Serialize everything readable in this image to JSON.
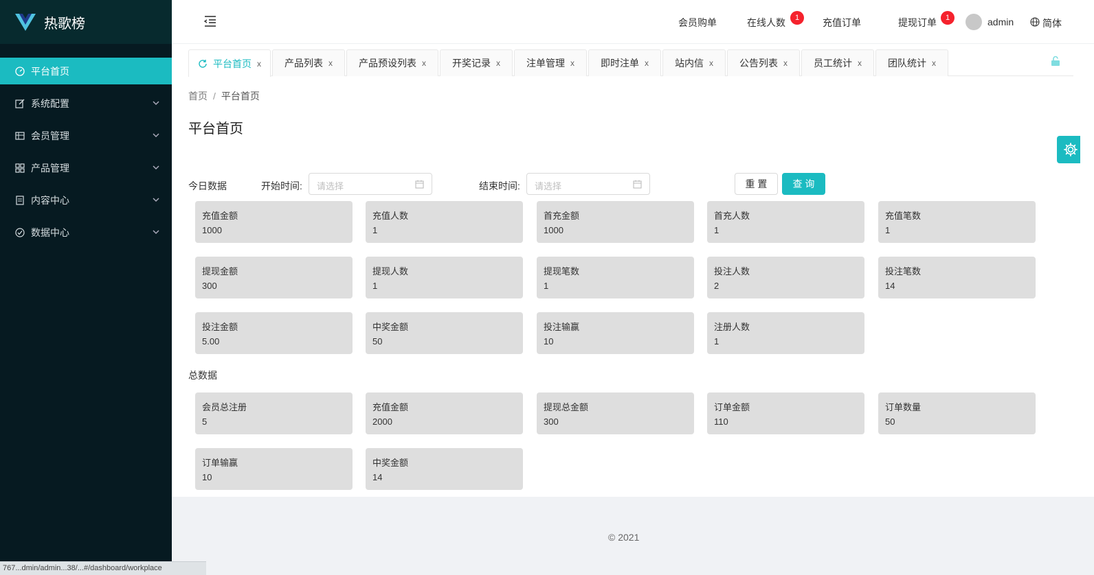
{
  "app": {
    "title": "热歌榜"
  },
  "sidebar": {
    "items": [
      {
        "label": "平台首页",
        "icon": "dashboard-icon",
        "active": true
      },
      {
        "label": "系统配置",
        "icon": "edit-icon"
      },
      {
        "label": "会员管理",
        "icon": "table-icon"
      },
      {
        "label": "产品管理",
        "icon": "grid-icon"
      },
      {
        "label": "内容中心",
        "icon": "document-icon"
      },
      {
        "label": "数据中心",
        "icon": "check-circle-icon"
      }
    ]
  },
  "header": {
    "links": [
      "会员购单",
      "在线人数",
      "充值订单",
      "提现订单"
    ],
    "online_badge": "1",
    "withdraw_badge": "1",
    "user": "admin",
    "language": "简体"
  },
  "tabs": [
    {
      "label": "平台首页",
      "active": true
    },
    {
      "label": "产品列表"
    },
    {
      "label": "产品预设列表"
    },
    {
      "label": "开奖记录"
    },
    {
      "label": "注单管理"
    },
    {
      "label": "即时注单"
    },
    {
      "label": "站内信"
    },
    {
      "label": "公告列表"
    },
    {
      "label": "员工统计"
    },
    {
      "label": "团队统计"
    }
  ],
  "tab_close": "x",
  "breadcrumb": {
    "home": "首页",
    "separator": "/",
    "current": "平台首页"
  },
  "page_title": "平台首页",
  "filter": {
    "today_label": "今日数据",
    "start_label": "开始时间:",
    "end_label": "结束时间:",
    "start_placeholder": "请选择",
    "end_placeholder": "请选择",
    "reset": "重 置",
    "query": "查 询"
  },
  "today_stats": [
    {
      "label": "充值金额",
      "value": "1000"
    },
    {
      "label": "充值人数",
      "value": "1"
    },
    {
      "label": "首充金额",
      "value": "1000"
    },
    {
      "label": "首充人数",
      "value": "1"
    },
    {
      "label": "充值笔数",
      "value": "1"
    },
    {
      "label": "提现金额",
      "value": "300"
    },
    {
      "label": "提现人数",
      "value": "1"
    },
    {
      "label": "提现笔数",
      "value": "1"
    },
    {
      "label": "投注人数",
      "value": "2"
    },
    {
      "label": "投注笔数",
      "value": "14"
    },
    {
      "label": "投注金额",
      "value": "5.00"
    },
    {
      "label": "中奖金额",
      "value": "50"
    },
    {
      "label": "投注输赢",
      "value": "10"
    },
    {
      "label": "注册人数",
      "value": "1"
    }
  ],
  "total_label": "总数据",
  "total_stats": [
    {
      "label": "会员总注册",
      "value": "5"
    },
    {
      "label": "充值金额",
      "value": "2000"
    },
    {
      "label": "提现总金额",
      "value": "300"
    },
    {
      "label": "订单金额",
      "value": "110"
    },
    {
      "label": "订单数量",
      "value": "50"
    },
    {
      "label": "订单输赢",
      "value": "10"
    },
    {
      "label": "中奖金额",
      "value": "14"
    }
  ],
  "footer": {
    "copyright": "© 2021"
  },
  "status_bar": "767...dmin/admin...38/...#/dashboard/workplace",
  "colors": {
    "accent": "#1bbbc1",
    "sidebar": "#061a21",
    "badge": "#f5222d",
    "card": "#dedede"
  }
}
